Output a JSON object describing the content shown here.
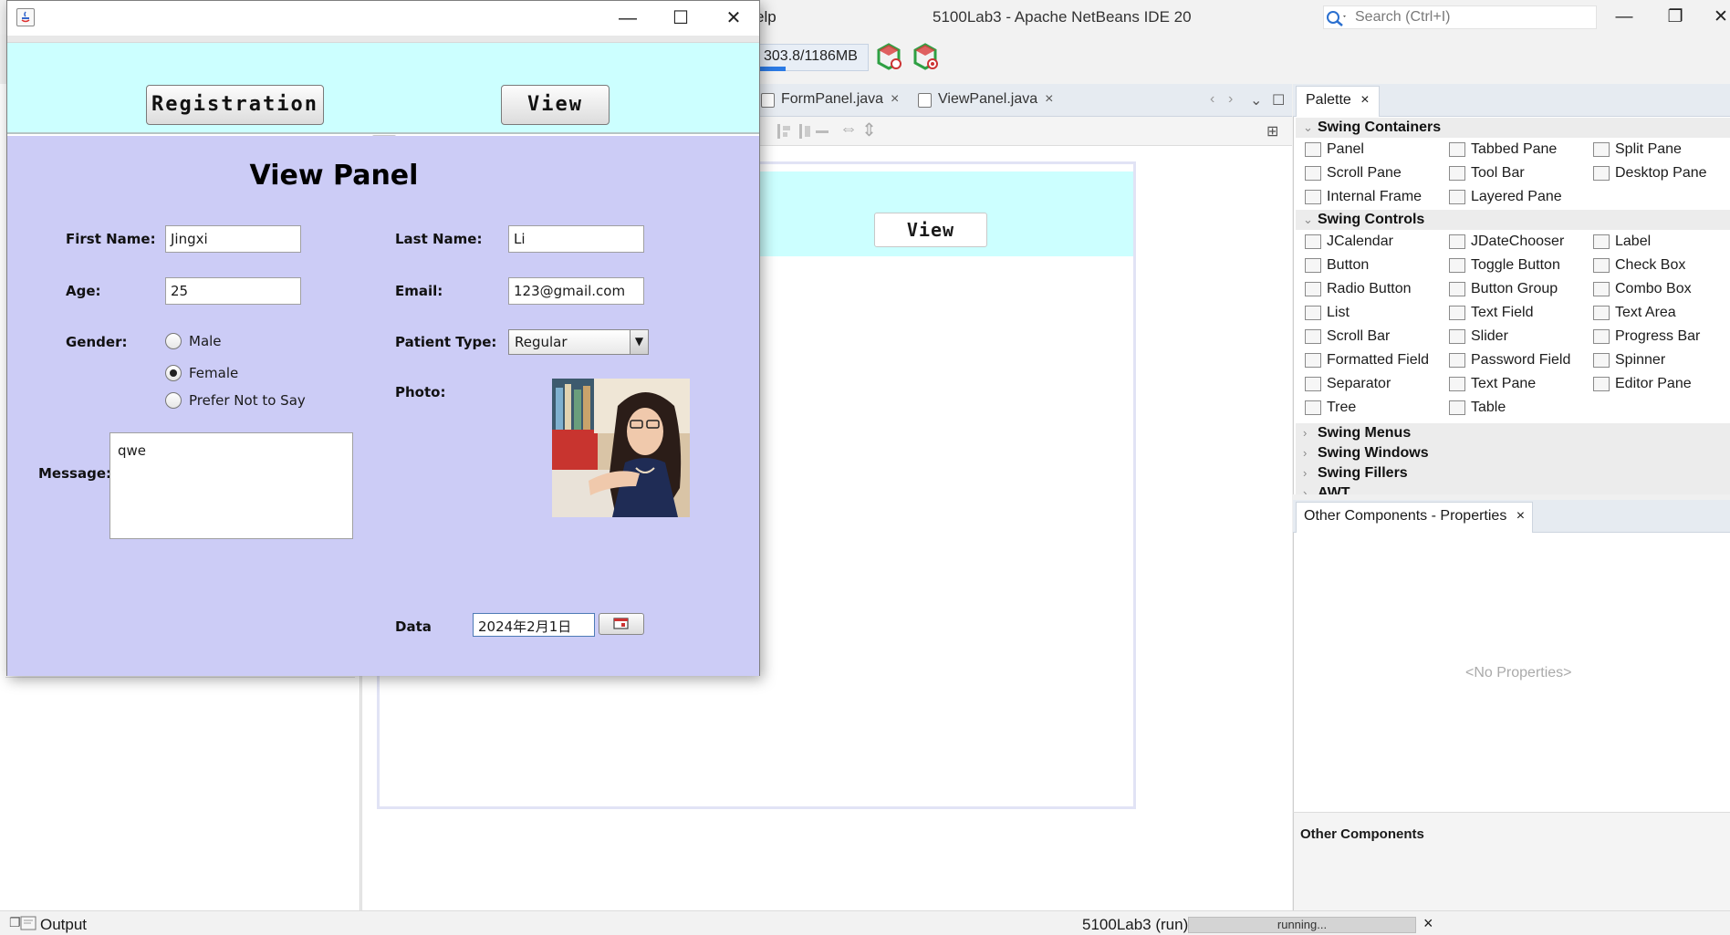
{
  "ide": {
    "title": "5100Lab3 - Apache NetBeans IDE 20",
    "menu_fragment": "elp",
    "search_placeholder": "Search (Ctrl+I)",
    "memory": {
      "text": "303.8/1186MB",
      "used_fraction": 0.26
    },
    "editor_tabs": [
      {
        "label": "FormPanel.java",
        "close": "×"
      },
      {
        "label": "ViewPanel.java",
        "close": "×"
      }
    ],
    "design_view_button": "View",
    "palette": {
      "tab_label": "Palette",
      "tab_close": "×",
      "categories": {
        "swing_containers": "Swing Containers",
        "swing_controls": "Swing Controls",
        "swing_menus": "Swing Menus",
        "swing_windows": "Swing Windows",
        "swing_fillers": "Swing Fillers",
        "awt": "AWT"
      },
      "containers": [
        "Panel",
        "Tabbed Pane",
        "Split Pane",
        "Scroll Pane",
        "Tool Bar",
        "Desktop Pane",
        "Internal Frame",
        "Layered Pane"
      ],
      "controls": [
        "JCalendar",
        "JDateChooser",
        "Label",
        "Button",
        "Toggle Button",
        "Check Box",
        "Radio Button",
        "Button Group",
        "Combo Box",
        "List",
        "Text Field",
        "Text Area",
        "Scroll Bar",
        "Slider",
        "Progress Bar",
        "Formatted Field",
        "Password Field",
        "Spinner",
        "Separator",
        "Text Pane",
        "Editor Pane",
        "Tree",
        "Table"
      ]
    },
    "properties": {
      "tab_label": "Other Components - Properties",
      "tab_close": "×",
      "empty_text": "<No Properties>",
      "footer_title": "Other Components"
    },
    "status": {
      "output_label": "Output",
      "run_label": "5100Lab3 (run)",
      "progress_text": "running...",
      "close": "×"
    },
    "window_controls": {
      "minimize": "—",
      "restore": "❐",
      "close": "✕"
    }
  },
  "app": {
    "window_controls": {
      "minimize": "—",
      "maximize": "☐",
      "close": "✕"
    },
    "buttons": {
      "registration": "Registration",
      "view": "View"
    },
    "view_panel": {
      "title": "View Panel",
      "labels": {
        "first_name": "First Name:",
        "last_name": "Last Name:",
        "age": "Age:",
        "email": "Email:",
        "gender": "Gender:",
        "patient_type": "Patient Type:",
        "photo": "Photo:",
        "message": "Message:",
        "date": "Data"
      },
      "values": {
        "first_name": "Jingxi",
        "last_name": "Li",
        "age": "25",
        "email": "123@gmail.com",
        "patient_type": "Regular",
        "message": "qwe",
        "date": "2024年2月1日"
      },
      "gender_options": [
        {
          "label": "Male",
          "selected": false
        },
        {
          "label": "Female",
          "selected": true
        },
        {
          "label": "Prefer Not to Say",
          "selected": false
        }
      ]
    }
  },
  "colors": {
    "header_cyan": "#ccffff",
    "panel_lavender": "#ccccf6",
    "memory_blue": "#2c7be5"
  }
}
